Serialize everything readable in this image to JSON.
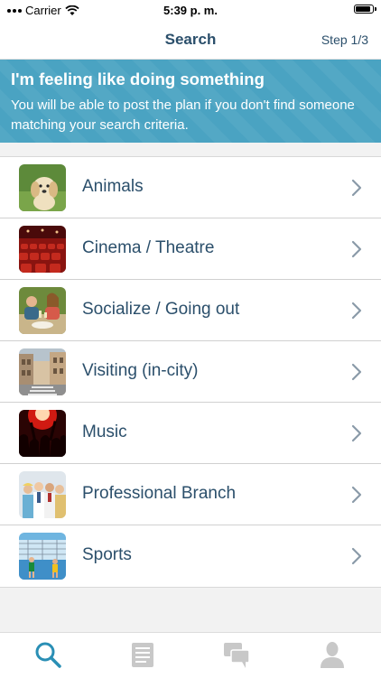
{
  "status_bar": {
    "carrier": "Carrier",
    "time": "5:39 p. m.",
    "battery_level": 0.95
  },
  "nav": {
    "title": "Search",
    "step": "Step 1/3"
  },
  "banner": {
    "title": "I'm feeling like doing something",
    "text": "You will be able to post the plan if you don't find someone matching your search criteria.",
    "background_color": "#4aa3c2"
  },
  "categories": [
    {
      "label": "Animals",
      "icon": "puppy-photo"
    },
    {
      "label": "Cinema / Theatre",
      "icon": "theater-seats-photo"
    },
    {
      "label": "Socialize / Going out",
      "icon": "friends-dining-photo"
    },
    {
      "label": "Visiting (in-city)",
      "icon": "city-street-photo"
    },
    {
      "label": "Music",
      "icon": "concert-crowd-photo"
    },
    {
      "label": "Professional Branch",
      "icon": "professionals-photo"
    },
    {
      "label": "Sports",
      "icon": "tennis-court-photo"
    }
  ],
  "tab_bar": {
    "items": [
      {
        "name": "search",
        "icon": "search-icon",
        "active": true
      },
      {
        "name": "plans",
        "icon": "document-icon",
        "active": false
      },
      {
        "name": "messages",
        "icon": "chat-icon",
        "active": false
      },
      {
        "name": "profile",
        "icon": "person-icon",
        "active": false
      }
    ],
    "active_color": "#2a8fb5",
    "inactive_color": "#c8c8c8"
  }
}
